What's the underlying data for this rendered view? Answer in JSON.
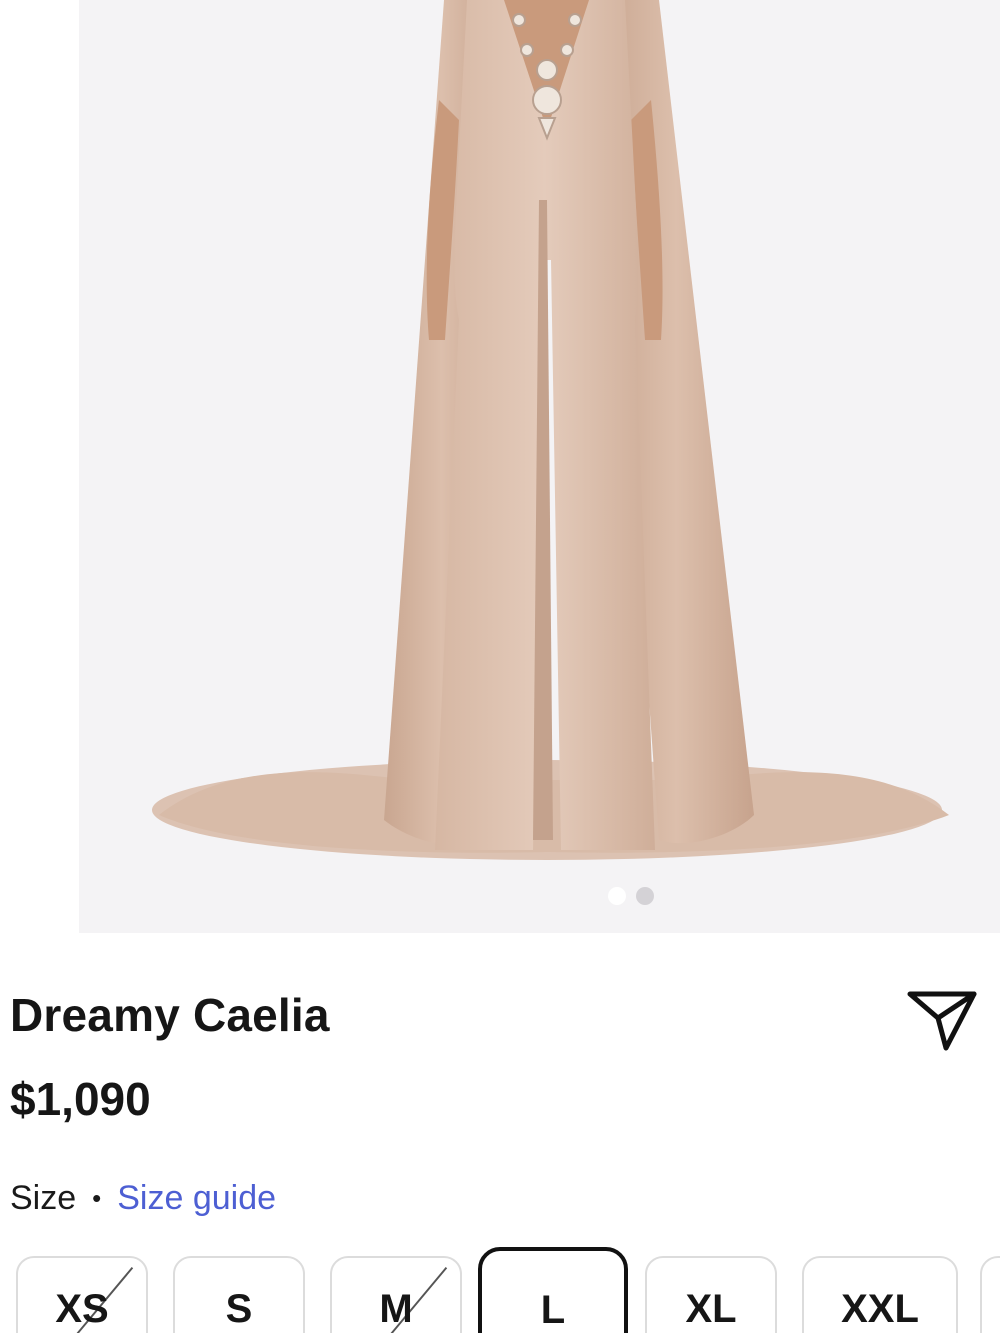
{
  "product": {
    "image_alt": "",
    "carousel": {
      "total": 2,
      "active_index": 0
    },
    "title": "Dreamy Caelia",
    "price": "$1,090"
  },
  "size": {
    "label": "Size",
    "separator": "•",
    "guide_link": "Size guide",
    "options": [
      {
        "label": "XS",
        "available": false,
        "selected": false
      },
      {
        "label": "S",
        "available": true,
        "selected": false
      },
      {
        "label": "M",
        "available": false,
        "selected": false
      },
      {
        "label": "L",
        "available": true,
        "selected": true
      },
      {
        "label": "XL",
        "available": true,
        "selected": false
      },
      {
        "label": "XXL",
        "available": true,
        "selected": false
      }
    ]
  },
  "colors": {
    "image_bg": "#f4f3f5",
    "fabric": "#dcbfac",
    "link": "#4d5fd3"
  },
  "icons": {
    "share": "paper-plane-icon"
  }
}
